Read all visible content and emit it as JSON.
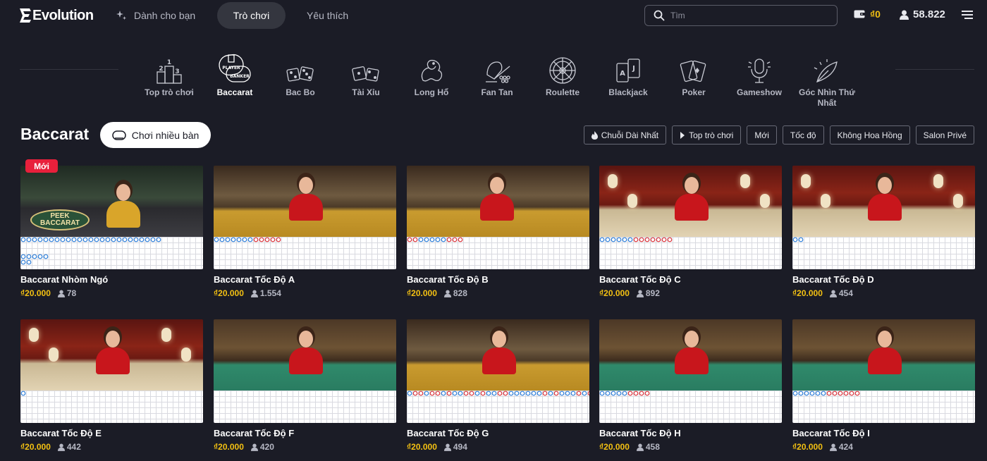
{
  "header": {
    "logo_text": "Evolution",
    "nav": [
      {
        "label": "Dành cho bạn"
      },
      {
        "label": "Trò chơi",
        "active": true
      },
      {
        "label": "Yêu thích"
      }
    ],
    "search_placeholder": "Tìm",
    "wallet_amount": "₫0",
    "online_players": "58.822"
  },
  "categories": [
    {
      "label": "Top trò chơi",
      "icon": "podium-icon"
    },
    {
      "label": "Baccarat",
      "icon": "baccarat-icon",
      "active": true
    },
    {
      "label": "Bac Bo",
      "icon": "dice-icon"
    },
    {
      "label": "Tài Xỉu",
      "icon": "dice-icon"
    },
    {
      "label": "Long Hổ",
      "icon": "dragon-tiger-icon"
    },
    {
      "label": "Fan Tan",
      "icon": "fan-tan-icon"
    },
    {
      "label": "Roulette",
      "icon": "roulette-icon"
    },
    {
      "label": "Blackjack",
      "icon": "cards-icon"
    },
    {
      "label": "Poker",
      "icon": "poker-icon"
    },
    {
      "label": "Gameshow",
      "icon": "microphone-icon"
    },
    {
      "label": "Góc Nhìn Thứ Nhất",
      "icon": "first-person-icon"
    }
  ],
  "section": {
    "title": "Baccarat",
    "multi_play_label": "Chơi nhiều bàn",
    "filters": [
      {
        "label": "Chuỗi Dài Nhất",
        "icon": "fire-icon"
      },
      {
        "label": "Top trò chơi",
        "icon": "chevron-right-icon"
      },
      {
        "label": "Mới"
      },
      {
        "label": "Tốc độ"
      },
      {
        "label": "Không Hoa Hồng"
      },
      {
        "label": "Salon Privé"
      }
    ]
  },
  "badge_new": "Mới",
  "colors": {
    "background": "#1b1c26",
    "gold": "#f3c012",
    "badge_red": "#e8203b",
    "player_blue": "#2f7fd8",
    "banker_red": "#d8343c"
  },
  "games": [
    {
      "name": "Baccarat Nhòm Ngó",
      "min_bet": "₫20.000",
      "players": "78",
      "theme": "peek",
      "badge": true,
      "thumb_text": "PEEK BACCARAT"
    },
    {
      "name": "Baccarat Tốc Độ A",
      "min_bet": "₫20.000",
      "players": "1.554",
      "theme": "gold"
    },
    {
      "name": "Baccarat Tốc Độ B",
      "min_bet": "₫20.000",
      "players": "828",
      "theme": "gold"
    },
    {
      "name": "Baccarat Tốc Độ C",
      "min_bet": "₫20.000",
      "players": "892",
      "theme": "red"
    },
    {
      "name": "Baccarat Tốc Độ D",
      "min_bet": "₫20.000",
      "players": "454",
      "theme": "red"
    },
    {
      "name": "Baccarat Tốc Độ E",
      "min_bet": "₫20.000",
      "players": "442",
      "theme": "red"
    },
    {
      "name": "Baccarat Tốc Độ F",
      "min_bet": "₫20.000",
      "players": "420",
      "theme": "green"
    },
    {
      "name": "Baccarat Tốc Độ G",
      "min_bet": "₫20.000",
      "players": "494",
      "theme": "gold"
    },
    {
      "name": "Baccarat Tốc Độ H",
      "min_bet": "₫20.000",
      "players": "458",
      "theme": "green"
    },
    {
      "name": "Baccarat Tốc Độ I",
      "min_bet": "₫20.000",
      "players": "424",
      "theme": "green"
    }
  ],
  "roadmaps": [
    [
      "BBBBBBBBBBBBBBBBBBBBBBBBB",
      "",
      "",
      "BBBBB",
      "BB"
    ],
    [
      "BBBBBBBRRRRR"
    ],
    [
      "RRBBBBBRRR"
    ],
    [
      "BBBBBBRRRRRRR"
    ],
    [
      "BB"
    ],
    [
      "B"
    ],
    [],
    [
      "BRRBRRBRBBRRBRBBRRBBBBBBRBRBBBRBRBRBR"
    ],
    [
      "BBBBBRRRR"
    ],
    [
      "BBBBBBRRRRRR"
    ]
  ]
}
